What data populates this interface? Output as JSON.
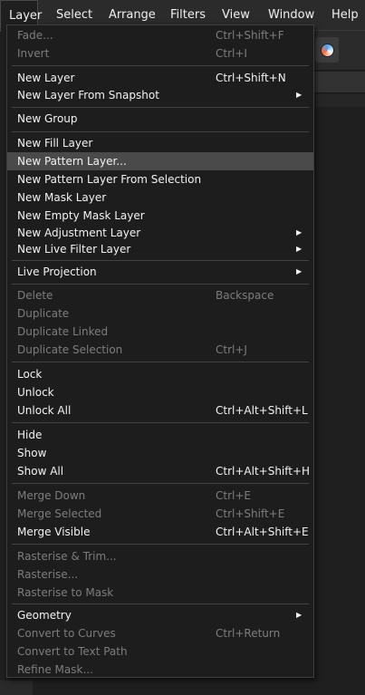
{
  "menubar": {
    "items": [
      {
        "label": "Layer",
        "active": true
      },
      {
        "label": "Select"
      },
      {
        "label": "Arrange"
      },
      {
        "label": "Filters"
      },
      {
        "label": "View"
      },
      {
        "label": "Window"
      },
      {
        "label": "Help"
      }
    ]
  },
  "menu": {
    "items": [
      {
        "label": "Fade...",
        "shortcut": "Ctrl+Shift+F",
        "enabled": false
      },
      {
        "label": "Invert",
        "shortcut": "Ctrl+I",
        "enabled": false
      },
      {
        "label": "New Layer",
        "shortcut": "Ctrl+Shift+N",
        "enabled": true
      },
      {
        "label": "New Layer From Snapshot",
        "shortcut": "",
        "enabled": true,
        "submenu": true
      },
      {
        "label": "New Group",
        "shortcut": "",
        "enabled": true
      },
      {
        "label": "New Fill Layer",
        "shortcut": "",
        "enabled": true
      },
      {
        "label": "New Pattern Layer...",
        "shortcut": "",
        "enabled": true,
        "highlighted": true
      },
      {
        "label": "New Pattern Layer From Selection",
        "shortcut": "",
        "enabled": true
      },
      {
        "label": "New Mask Layer",
        "shortcut": "",
        "enabled": true
      },
      {
        "label": "New Empty Mask Layer",
        "shortcut": "",
        "enabled": true
      },
      {
        "label": "New Adjustment Layer",
        "shortcut": "",
        "enabled": true,
        "submenu": true
      },
      {
        "label": "New Live Filter Layer",
        "shortcut": "",
        "enabled": true,
        "submenu": true
      },
      {
        "label": "Live Projection",
        "shortcut": "",
        "enabled": true,
        "submenu": true
      },
      {
        "label": "Delete",
        "shortcut": "Backspace",
        "enabled": false
      },
      {
        "label": "Duplicate",
        "shortcut": "",
        "enabled": false
      },
      {
        "label": "Duplicate Linked",
        "shortcut": "",
        "enabled": false
      },
      {
        "label": "Duplicate Selection",
        "shortcut": "Ctrl+J",
        "enabled": false
      },
      {
        "label": "Lock",
        "shortcut": "",
        "enabled": true
      },
      {
        "label": "Unlock",
        "shortcut": "",
        "enabled": true
      },
      {
        "label": "Unlock All",
        "shortcut": "Ctrl+Alt+Shift+L",
        "enabled": true
      },
      {
        "label": "Hide",
        "shortcut": "",
        "enabled": true
      },
      {
        "label": "Show",
        "shortcut": "",
        "enabled": true
      },
      {
        "label": "Show All",
        "shortcut": "Ctrl+Alt+Shift+H",
        "enabled": true
      },
      {
        "label": "Merge Down",
        "shortcut": "Ctrl+E",
        "enabled": false
      },
      {
        "label": "Merge Selected",
        "shortcut": "Ctrl+Shift+E",
        "enabled": false
      },
      {
        "label": "Merge Visible",
        "shortcut": "Ctrl+Alt+Shift+E",
        "enabled": true
      },
      {
        "label": "Rasterise & Trim...",
        "shortcut": "",
        "enabled": false
      },
      {
        "label": "Rasterise...",
        "shortcut": "",
        "enabled": false
      },
      {
        "label": "Rasterise to Mask",
        "shortcut": "",
        "enabled": false
      },
      {
        "label": "Geometry",
        "shortcut": "",
        "enabled": true,
        "submenu": true
      },
      {
        "label": "Convert to Curves",
        "shortcut": "Ctrl+Return",
        "enabled": false
      },
      {
        "label": "Convert to Text Path",
        "shortcut": "",
        "enabled": false
      },
      {
        "label": "Refine Mask...",
        "shortcut": "",
        "enabled": false
      }
    ]
  },
  "icons": {
    "submenu_arrow": "chevron-right-icon",
    "color_picker": "color-wheel-icon"
  },
  "colors": {
    "menu_bg": "#1d1d1d",
    "highlight_bg": "#4a4a4a",
    "enabled_text": "#f2f2f2",
    "disabled_text": "#7d7d7d"
  }
}
